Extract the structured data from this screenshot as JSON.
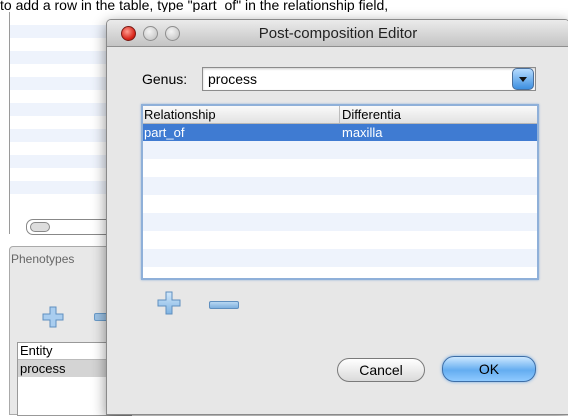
{
  "instruction_text": "to add a row in the table, type \"part_of\" in the relationship field,",
  "phenotypes_panel": {
    "title": "Phenotypes",
    "table": {
      "header": "Entity",
      "row_value": "process"
    }
  },
  "dialog": {
    "title": "Post-composition Editor",
    "genus": {
      "label": "Genus:",
      "value": "process"
    },
    "table": {
      "columns": [
        "Relationship",
        "Differentia"
      ],
      "rows": [
        {
          "relationship": "part_of",
          "differentia": "maxilla",
          "selected": true
        }
      ]
    },
    "cancel_label": "Cancel",
    "ok_label": "OK"
  },
  "colors": {
    "selection": "#3f7bd2",
    "accent_blue": "#64adf0",
    "close_red": "#d8251a"
  },
  "icons": {
    "add": "plus-icon",
    "remove": "minus-icon",
    "dropdown": "chevron-down-icon"
  }
}
